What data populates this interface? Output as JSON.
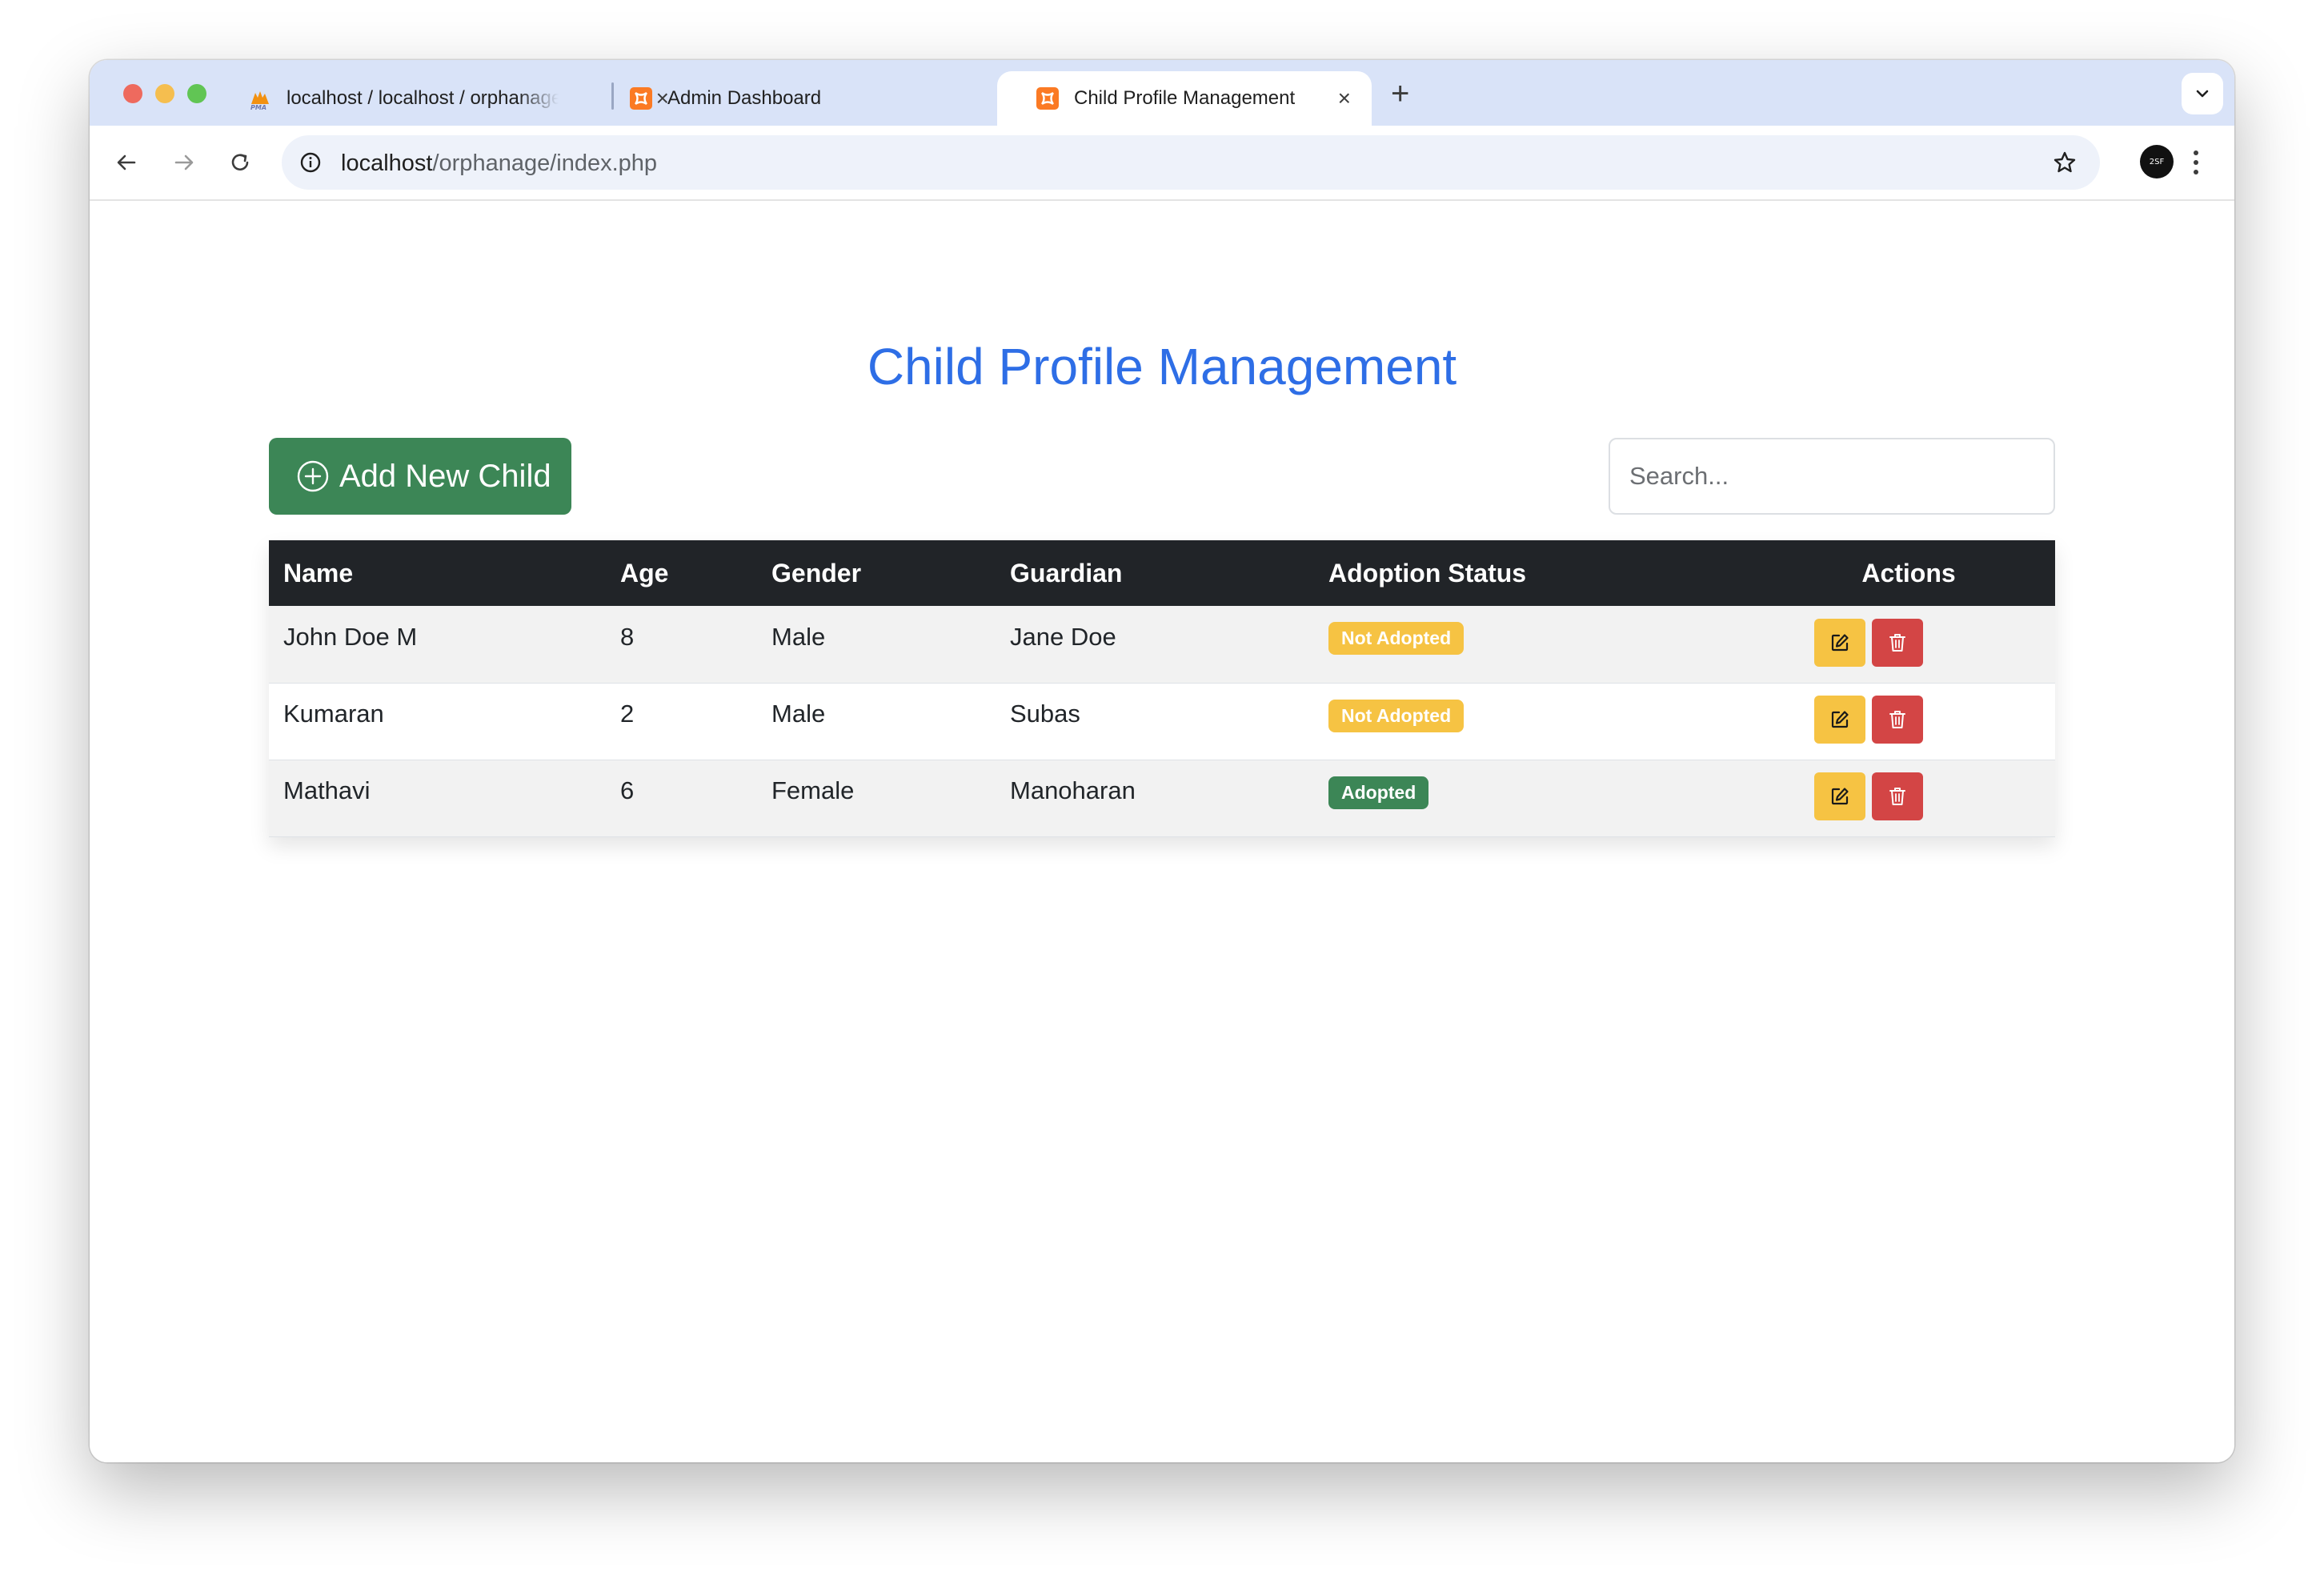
{
  "browser": {
    "tabs": [
      {
        "title": "localhost / localhost / orphanage",
        "favicon": "phpmyadmin-icon",
        "active": false
      },
      {
        "title": "Admin Dashboard",
        "favicon": "xampp-icon",
        "active": false
      },
      {
        "title": "Child Profile Management",
        "favicon": "xampp-icon",
        "active": true
      }
    ],
    "url_host": "localhost",
    "url_path": "/orphanage/index.php",
    "profile_label": "2SF"
  },
  "page": {
    "title": "Child Profile Management",
    "add_button_label": "Add New Child",
    "search_placeholder": "Search..."
  },
  "table": {
    "headers": {
      "name": "Name",
      "age": "Age",
      "gender": "Gender",
      "guardian": "Guardian",
      "status": "Adoption Status",
      "actions": "Actions"
    },
    "rows": [
      {
        "name": "John Doe M",
        "age": "8",
        "gender": "Male",
        "guardian": "Jane Doe",
        "status": "Not Adopted"
      },
      {
        "name": "Kumaran",
        "age": "2",
        "gender": "Male",
        "guardian": "Subas",
        "status": "Not Adopted"
      },
      {
        "name": "Mathavi",
        "age": "6",
        "gender": "Female",
        "guardian": "Manoharan",
        "status": "Adopted"
      }
    ]
  },
  "colors": {
    "title_blue": "#2e6ee6",
    "add_green": "#3c8656",
    "not_adopted_yellow": "#f6c343",
    "adopted_green": "#3c8656",
    "delete_red": "#d34545",
    "header_dark": "#212428"
  }
}
